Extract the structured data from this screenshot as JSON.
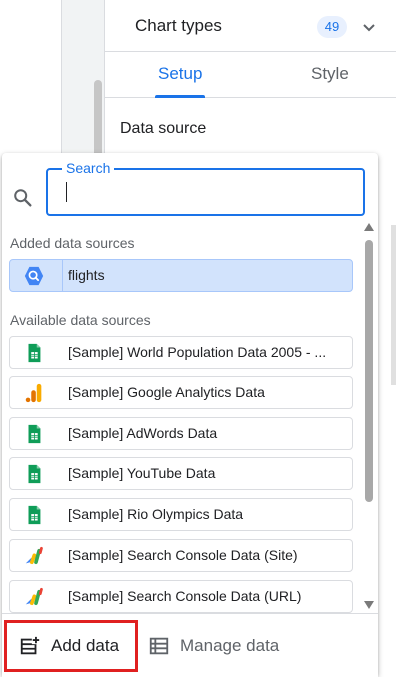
{
  "panel": {
    "title": "Chart types",
    "count": "49",
    "tabs": [
      {
        "label": "Setup",
        "active": true
      },
      {
        "label": "Style",
        "active": false
      }
    ],
    "section_title": "Data source"
  },
  "popup": {
    "search": {
      "label": "Search",
      "value": "",
      "placeholder": ""
    },
    "added_label": "Added data sources",
    "added_items": [
      {
        "label": "flights",
        "icon": "bigquery-icon",
        "selected": true
      }
    ],
    "available_label": "Available data sources",
    "available_items": [
      {
        "label": "[Sample] World Population Data 2005 - ...",
        "icon": "google-sheets-icon"
      },
      {
        "label": "[Sample] Google Analytics Data",
        "icon": "google-analytics-icon"
      },
      {
        "label": "[Sample] AdWords Data",
        "icon": "google-sheets-icon"
      },
      {
        "label": "[Sample] YouTube Data",
        "icon": "google-sheets-icon"
      },
      {
        "label": "[Sample] Rio Olympics Data",
        "icon": "google-sheets-icon"
      },
      {
        "label": "[Sample] Search Console Data (Site)",
        "icon": "search-console-icon"
      },
      {
        "label": "[Sample] Search Console Data (URL)",
        "icon": "search-console-icon"
      }
    ],
    "footer": {
      "add_label": "Add data",
      "manage_label": "Manage data"
    }
  },
  "colors": {
    "accent": "#1a73e8",
    "selected_bg": "#d2e3fc",
    "highlight_border": "#e02020",
    "sheets_green": "#0f9d58",
    "analytics_orange": "#f9ab00"
  }
}
